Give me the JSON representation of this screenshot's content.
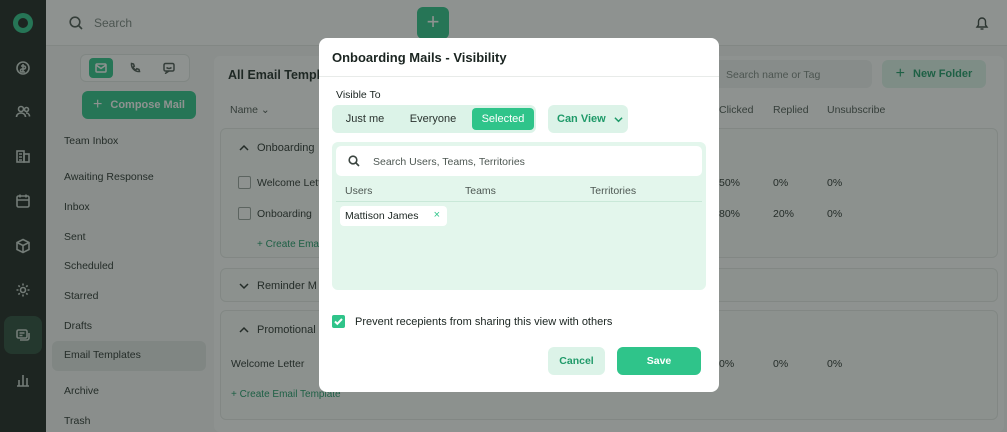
{
  "topbar": {
    "search_placeholder": "Search",
    "add_label": "+"
  },
  "sidebar": {
    "compose_label": "Compose Mail",
    "items": [
      "Team Inbox",
      "Awaiting Response",
      "Inbox",
      "Sent",
      "Scheduled",
      "Starred",
      "Drafts",
      "Email Templates",
      "Archive",
      "Trash"
    ],
    "active_item": "Email Templates"
  },
  "main": {
    "title": "All Email Templa",
    "search_placeholder": "Search name or Tag",
    "new_folder_label": "New Folder",
    "columns": {
      "name": "Name",
      "clicked": "Clicked",
      "replied": "Replied",
      "unsubscribe": "Unsubscribe"
    },
    "groups": [
      {
        "title": "Onboarding",
        "rows": [
          {
            "name": "Welcome Lett",
            "clicked": "50%",
            "replied": "0%",
            "unsub": "0%"
          },
          {
            "name": "Onboarding",
            "clicked": "80%",
            "replied": "20%",
            "unsub": "0%"
          }
        ],
        "create_label": "+ Create Ema"
      },
      {
        "title": "Reminder M"
      },
      {
        "title": "Promotional",
        "rows": [
          {
            "name": "Welcome Letter",
            "clicked": "0%",
            "replied": "0%",
            "unsub": "0%"
          }
        ],
        "create_label": "+ Create Email Template"
      }
    ]
  },
  "modal": {
    "title": "Onboarding Mails - Visibility",
    "visible_to_label": "Visible To",
    "segments": [
      "Just me",
      "Everyone",
      "Selected"
    ],
    "selected_segment": "Selected",
    "permission": "Can View",
    "search_placeholder": "Search Users, Teams, Territories",
    "columns": [
      "Users",
      "Teams",
      "Territories"
    ],
    "chips": [
      "Mattison James"
    ],
    "chip_remove": "×",
    "prevent_label": "Prevent recepients from sharing this view with others",
    "prevent_checked": true,
    "cancel_label": "Cancel",
    "save_label": "Save"
  },
  "colors": {
    "accent": "#2fc48a",
    "accent_light": "#dcf3e8",
    "rail": "#1c2520"
  }
}
